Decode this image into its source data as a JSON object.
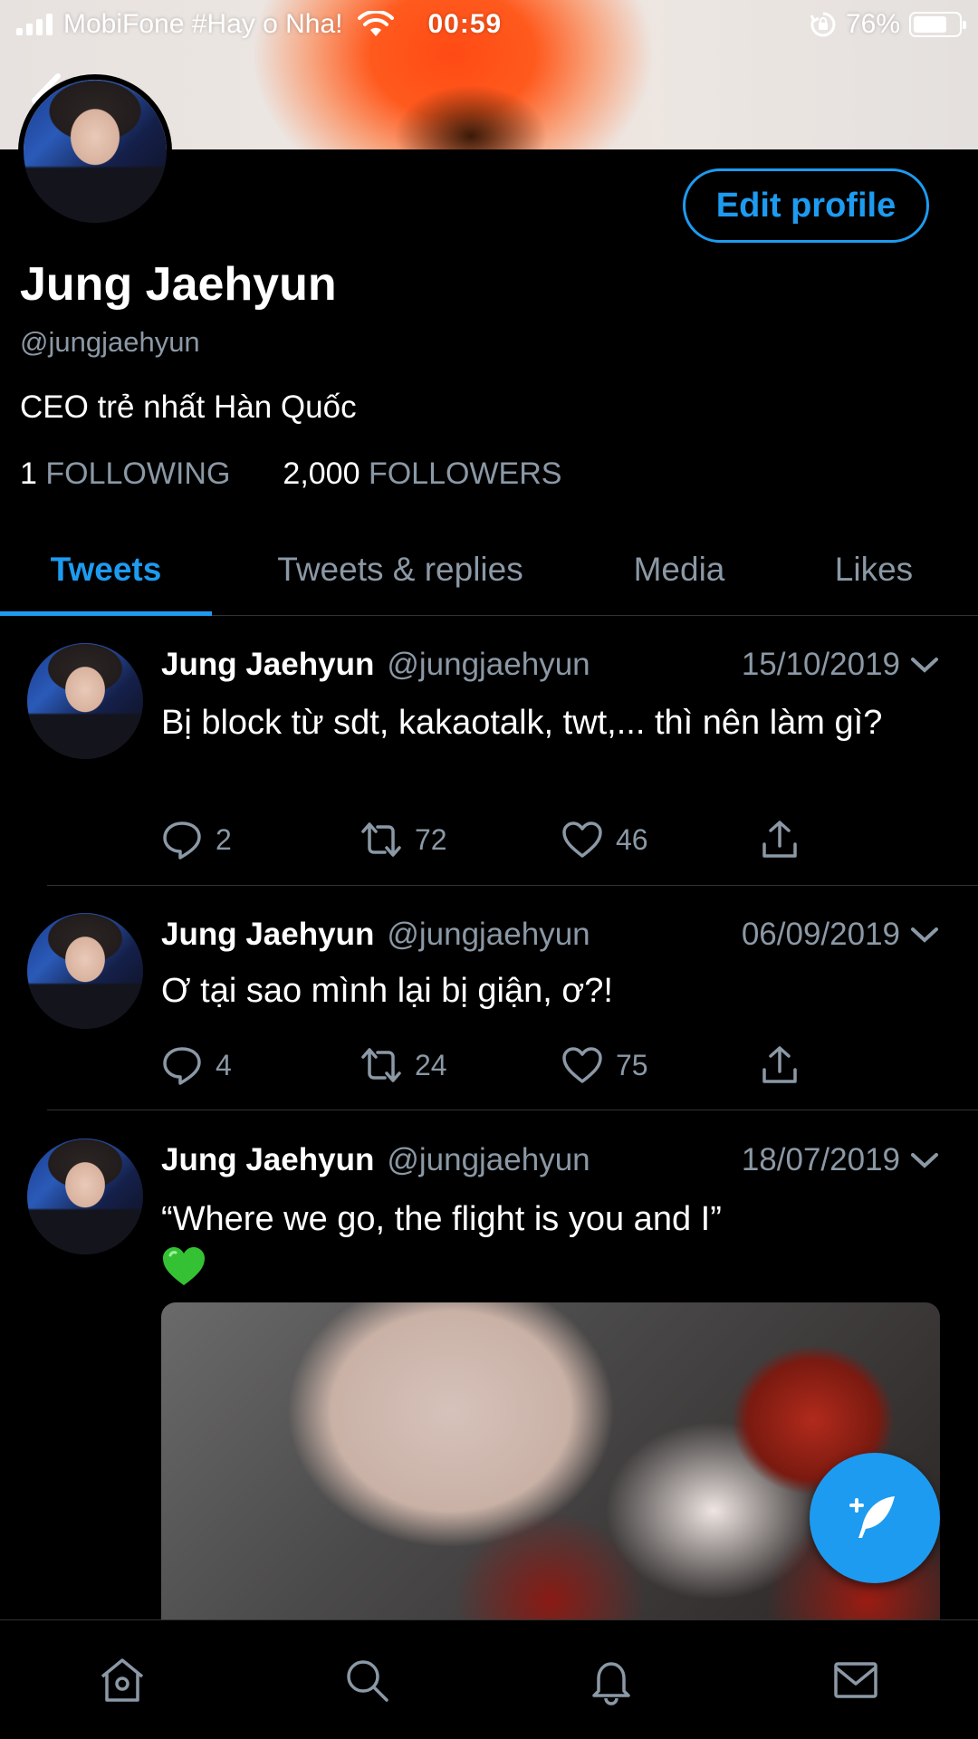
{
  "status_bar": {
    "carrier": "MobiFone #Hay o Nha!",
    "time": "00:59",
    "battery_text": "76%",
    "battery_level": 0.76
  },
  "profile": {
    "name": "Jung Jaehyun",
    "handle": "@jungjaehyun",
    "bio": "CEO trẻ nhất Hàn Quốc",
    "edit_button": "Edit profile",
    "following_count": "1",
    "following_label": "FOLLOWING",
    "followers_count": "2,000",
    "followers_label": "FOLLOWERS"
  },
  "tabs": [
    {
      "label": "Tweets",
      "active": true
    },
    {
      "label": "Tweets & replies",
      "active": false
    },
    {
      "label": "Media",
      "active": false
    },
    {
      "label": "Likes",
      "active": false
    }
  ],
  "tweets": [
    {
      "name": "Jung Jaehyun",
      "handle": "@jungjaehyun",
      "date": "15/10/2019",
      "text": "Bị block từ sdt, kakaotalk, twt,... thì nên làm gì?",
      "replies": "2",
      "retweets": "72",
      "likes": "46"
    },
    {
      "name": "Jung Jaehyun",
      "handle": "@jungjaehyun",
      "date": "06/09/2019",
      "text": "Ơ tại sao mình lại bị giận, ơ?!",
      "replies": "4",
      "retweets": "24",
      "likes": "75"
    },
    {
      "name": "Jung Jaehyun",
      "handle": "@jungjaehyun",
      "date": "18/07/2019",
      "text": "“Where we go, the flight is you and I”",
      "emoji": "green-heart"
    }
  ],
  "bottom_nav": [
    "home-icon",
    "search-icon",
    "notifications-icon",
    "messages-icon"
  ],
  "colors": {
    "accent": "#1d9bf0",
    "secondary_text": "#8b98a5",
    "background": "#000000"
  }
}
